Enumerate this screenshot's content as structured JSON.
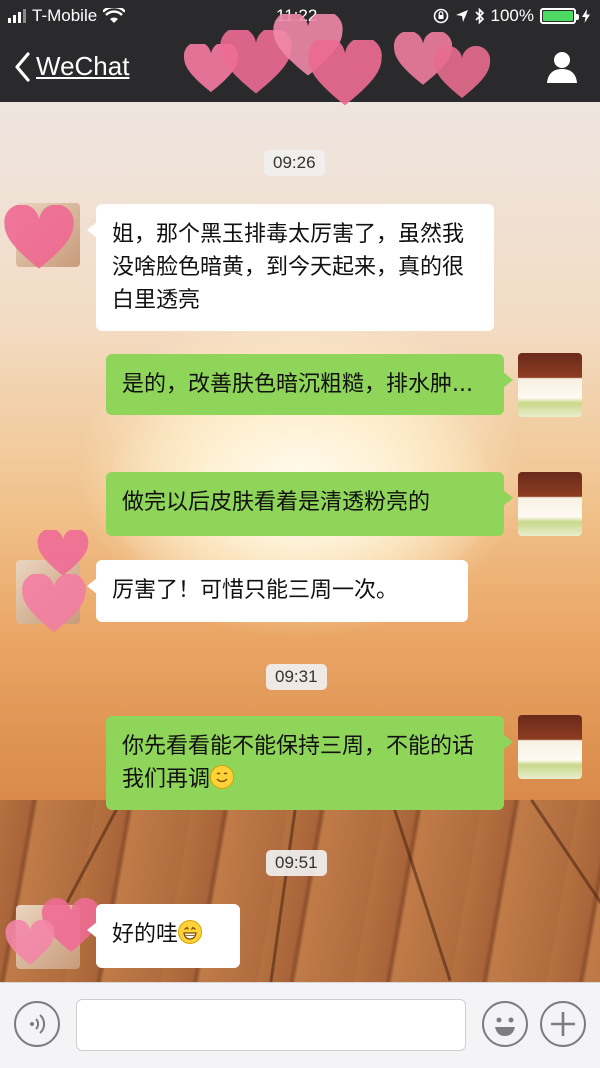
{
  "status_bar": {
    "carrier": "T-Mobile",
    "time": "11:22",
    "battery_percent": "100%",
    "battery_level": 1.0
  },
  "nav": {
    "back_label": "WeChat",
    "title": "",
    "profile_icon": "person-icon"
  },
  "messages": [
    {
      "type": "time",
      "text": "09:26"
    },
    {
      "type": "in",
      "text": "姐，那个黑玉排毒太厉害了，虽然我没啥脸色暗黄，到今天起来，真的很白里透亮"
    },
    {
      "type": "out",
      "text": "是的，改善肤色暗沉粗糙，排水肿..."
    },
    {
      "type": "out",
      "text": "做完以后皮肤看着是清透粉亮的"
    },
    {
      "type": "in",
      "text": "厉害了！可惜只能三周一次。"
    },
    {
      "type": "time",
      "text": "09:31"
    },
    {
      "type": "out",
      "text": "你先看看能不能保持三周，不能的话我们再调",
      "emoji": "smile-emoji"
    },
    {
      "type": "time",
      "text": "09:51"
    },
    {
      "type": "in",
      "text": "好的哇",
      "emoji": "grin-emoji"
    }
  ],
  "input_bar": {
    "voice_icon": "voice-icon",
    "emoji_icon": "emoji-icon",
    "plus_icon": "plus-icon",
    "field_value": ""
  },
  "colors": {
    "nav_bg": "#2a2a2c",
    "outgoing_bubble": "#8ed559",
    "incoming_bubble": "#ffffff",
    "battery": "#4cd964"
  }
}
